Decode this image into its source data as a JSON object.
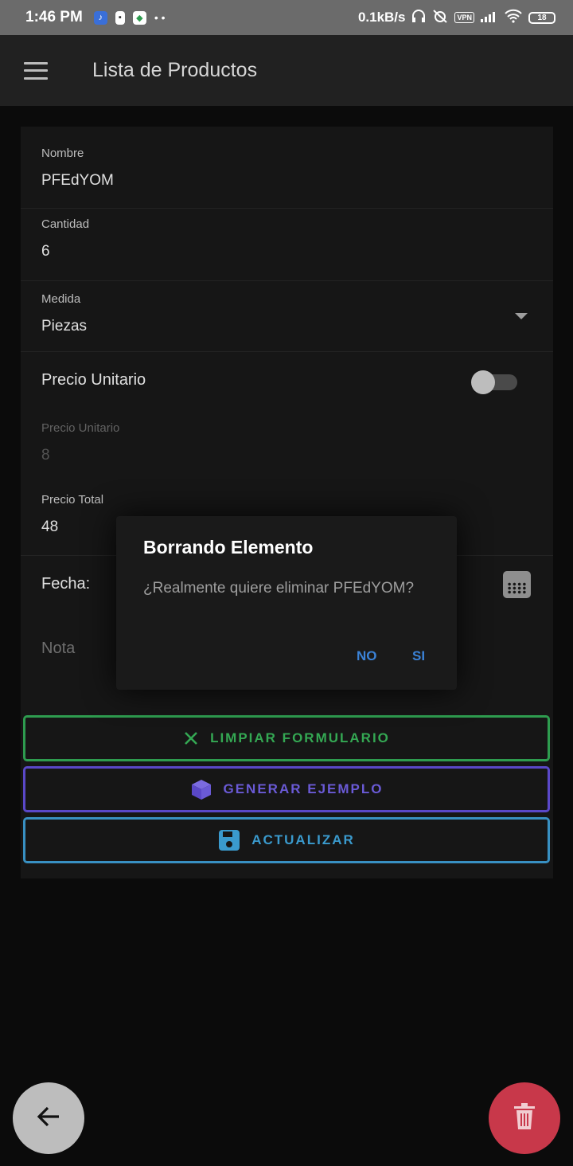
{
  "status_bar": {
    "time": "1:46 PM",
    "speed": "0.1kB/s",
    "vpn": "VPN",
    "battery": "18"
  },
  "appbar": {
    "title": "Lista de Productos"
  },
  "form": {
    "nombre": {
      "label": "Nombre",
      "value": "PFEdYOM"
    },
    "cantidad": {
      "label": "Cantidad",
      "value": "6"
    },
    "medida": {
      "label": "Medida",
      "value": "Piezas"
    },
    "precio_toggle": {
      "label": "Precio Unitario",
      "on": false
    },
    "precio_unitario": {
      "label": "Precio Unitario",
      "value": "8"
    },
    "precio_total": {
      "label": "Precio Total",
      "value": "48"
    },
    "fecha": {
      "label": "Fecha:"
    },
    "nota": {
      "placeholder": "Nota"
    }
  },
  "buttons": {
    "clear": "LIMPIAR FORMULARIO",
    "generate": "GENERAR EJEMPLO",
    "update": "ACTUALIZAR"
  },
  "dialog": {
    "title": "Borrando Elemento",
    "message": "¿Realmente quiere eliminar PFEdYOM?",
    "no": "NO",
    "si": "SI"
  },
  "colors": {
    "clear": "#34a853",
    "generate": "#6a5ad6",
    "update": "#3a9acd",
    "delete_fab": "#c8384a",
    "dialog_action": "#3b82d6"
  },
  "icons": {
    "menu": "hamburger-icon",
    "calendar": "calendar-icon",
    "clear": "close-icon",
    "generate": "cube-icon",
    "update": "save-icon",
    "back": "arrow-left-icon",
    "delete": "trash-icon"
  }
}
